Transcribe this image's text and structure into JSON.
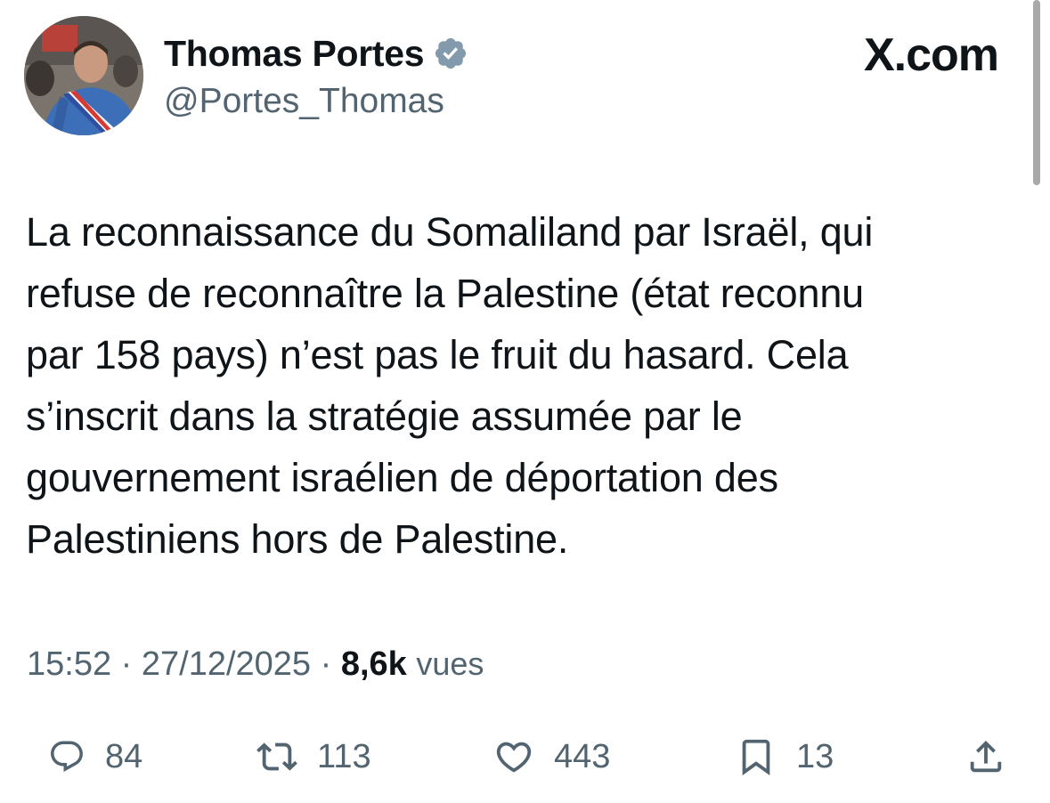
{
  "author": {
    "name": "Thomas Portes",
    "handle": "@Portes_Thomas",
    "verified": true
  },
  "brand": "X.com",
  "tweet": {
    "lines": [
      "La reconnaissance du Somaliland par Israël, qui",
      "refuse de reconnaître la Palestine (état reconnu",
      "par 158 pays) n’est pas le fruit du hasard. Cela",
      "s’inscrit dans la stratégie assumée par le",
      "gouvernement israélien de déportation des",
      "Palestiniens hors de Palestine."
    ]
  },
  "meta": {
    "time": "15:52",
    "separator": "·",
    "date": "27/12/2025",
    "views_count": "8,6k",
    "views_label": "vues"
  },
  "actions": {
    "reply": {
      "icon": "reply-icon",
      "count": "84"
    },
    "retweet": {
      "icon": "retweet-icon",
      "count": "113"
    },
    "like": {
      "icon": "heart-icon",
      "count": "443"
    },
    "bookmark": {
      "icon": "bookmark-icon",
      "count": "13"
    },
    "share": {
      "icon": "share-icon"
    }
  },
  "colors": {
    "text_primary": "#0f1419",
    "text_secondary": "#536471",
    "verified_badge": "#829aab"
  }
}
